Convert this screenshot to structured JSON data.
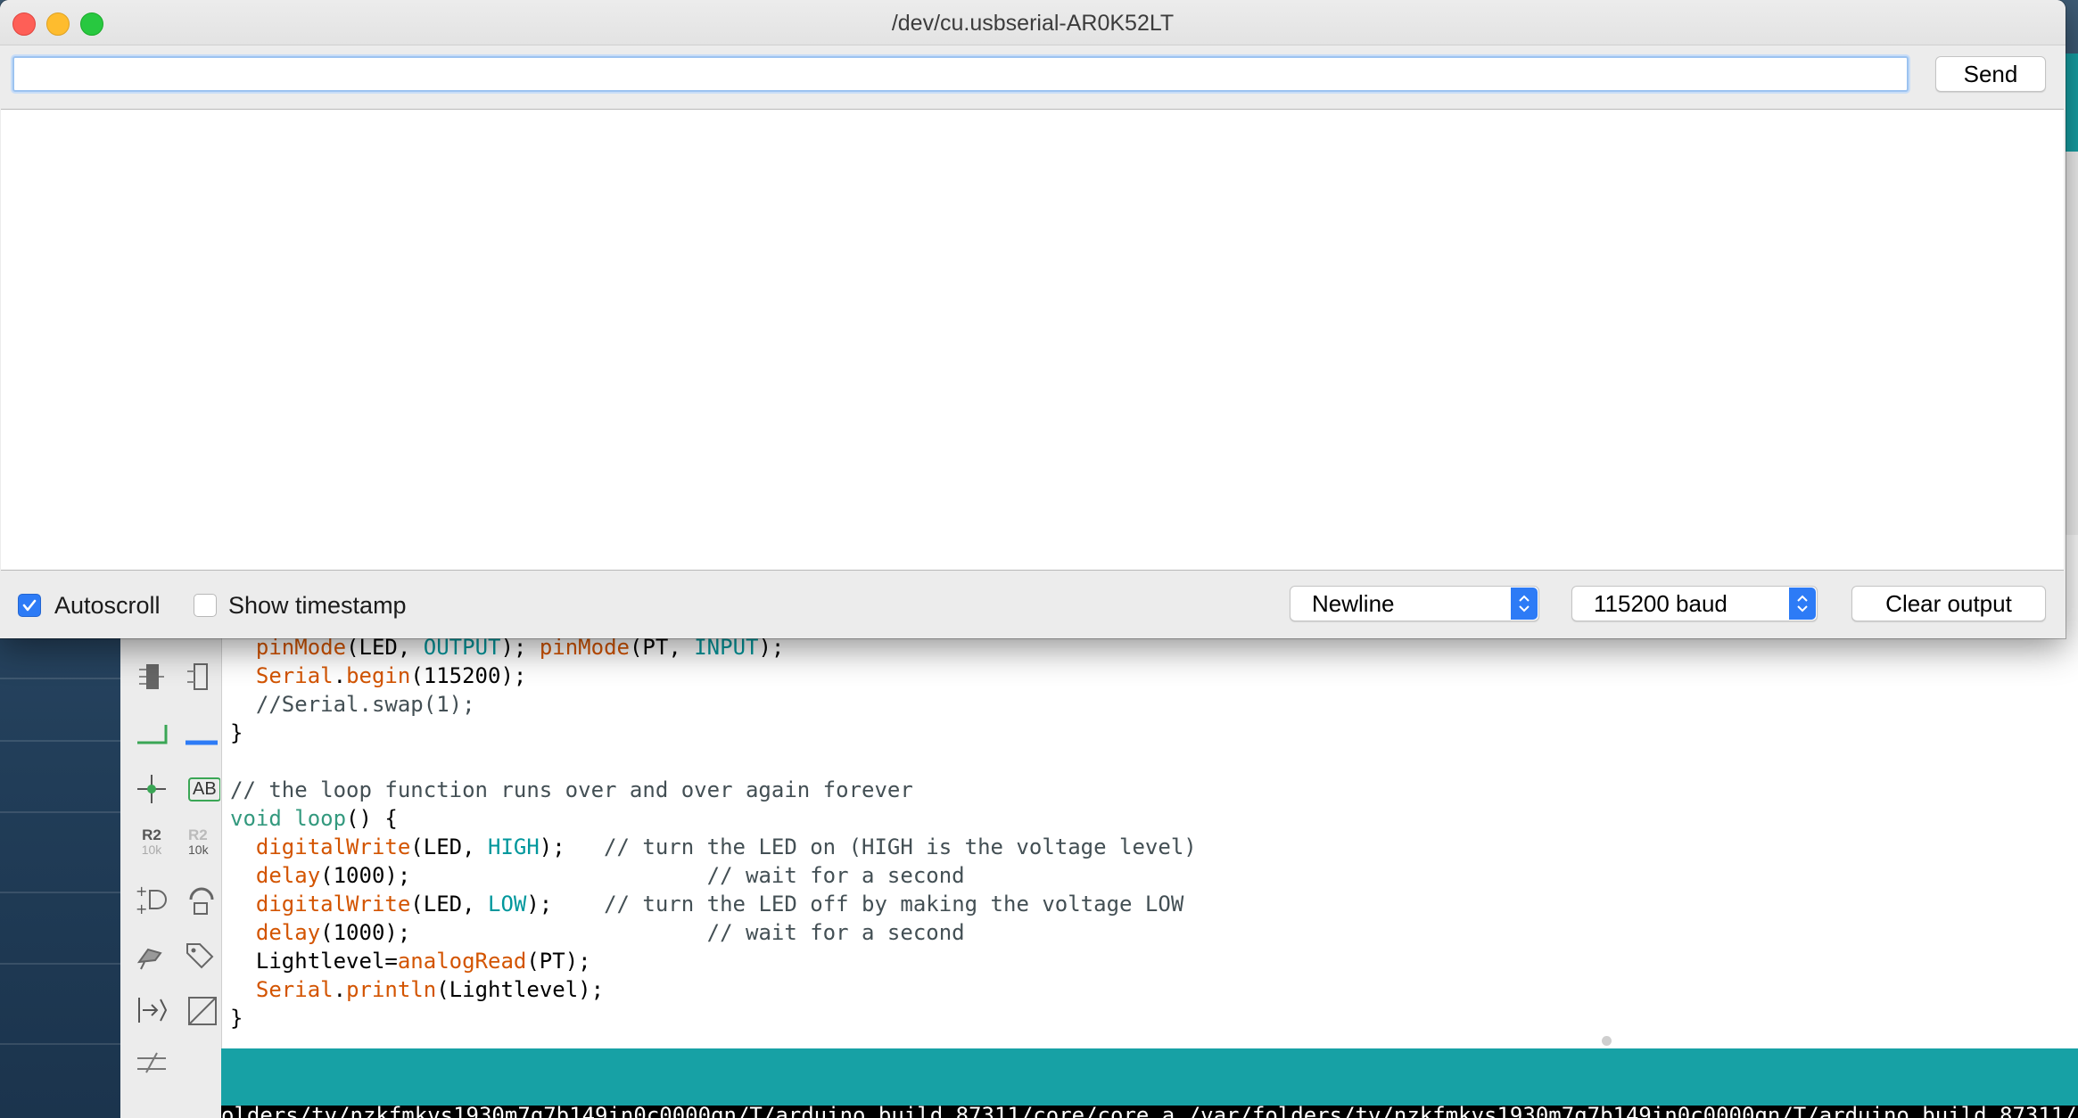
{
  "serial_monitor": {
    "title": "/dev/cu.usbserial-AR0K52LT",
    "input_value": "",
    "send_label": "Send",
    "autoscroll": {
      "label": "Autoscroll",
      "checked": true
    },
    "show_timestamp": {
      "label": "Show timestamp",
      "checked": false
    },
    "line_ending": "Newline",
    "baud_rate": "115200 baud",
    "clear_label": "Clear output",
    "output": ""
  },
  "editor": {
    "tool_labels": {
      "resistor_name": "R2",
      "resistor_value": "10k",
      "text_tool": "AB"
    },
    "code_lines": [
      [
        {
          "t": "  "
        },
        {
          "t": "pinMode",
          "c": "fn"
        },
        {
          "t": "(LED, "
        },
        {
          "t": "OUTPUT",
          "c": "const"
        },
        {
          "t": "); "
        },
        {
          "t": "pinMode",
          "c": "fn"
        },
        {
          "t": "(PT, "
        },
        {
          "t": "INPUT",
          "c": "const"
        },
        {
          "t": ");"
        }
      ],
      [
        {
          "t": "  "
        },
        {
          "t": "Serial",
          "c": "fn"
        },
        {
          "t": "."
        },
        {
          "t": "begin",
          "c": "fn"
        },
        {
          "t": "(115200);"
        }
      ],
      [
        {
          "t": "  //Serial.swap(1);",
          "c": "cm"
        }
      ],
      [
        {
          "t": "}"
        }
      ],
      [
        {
          "t": ""
        }
      ],
      [
        {
          "t": "// the loop function runs over and over again forever",
          "c": "cm"
        }
      ],
      [
        {
          "t": "void",
          "c": "kw"
        },
        {
          "t": " "
        },
        {
          "t": "loop",
          "c": "kw"
        },
        {
          "t": "() {"
        }
      ],
      [
        {
          "t": "  "
        },
        {
          "t": "digitalWrite",
          "c": "fn"
        },
        {
          "t": "(LED, "
        },
        {
          "t": "HIGH",
          "c": "const"
        },
        {
          "t": ");   "
        },
        {
          "t": "// turn the LED on (HIGH is the voltage level)",
          "c": "cm"
        }
      ],
      [
        {
          "t": "  "
        },
        {
          "t": "delay",
          "c": "fn"
        },
        {
          "t": "(1000);                       "
        },
        {
          "t": "// wait for a second",
          "c": "cm"
        }
      ],
      [
        {
          "t": "  "
        },
        {
          "t": "digitalWrite",
          "c": "fn"
        },
        {
          "t": "(LED, "
        },
        {
          "t": "LOW",
          "c": "const"
        },
        {
          "t": ");    "
        },
        {
          "t": "// turn the LED off by making the voltage LOW",
          "c": "cm"
        }
      ],
      [
        {
          "t": "  "
        },
        {
          "t": "delay",
          "c": "fn"
        },
        {
          "t": "(1000);                       "
        },
        {
          "t": "// wait for a second",
          "c": "cm"
        }
      ],
      [
        {
          "t": "  Lightlevel="
        },
        {
          "t": "analogRead",
          "c": "fn"
        },
        {
          "t": "(PT);"
        }
      ],
      [
        {
          "t": "  "
        },
        {
          "t": "Serial",
          "c": "fn"
        },
        {
          "t": "."
        },
        {
          "t": "println",
          "c": "fn"
        },
        {
          "t": "(Lightlevel);"
        }
      ],
      [
        {
          "t": "}"
        }
      ]
    ],
    "console_text": "olders/tv/nzkfmkvs1930m7q7b149in0c0000gn/T/arduino_build_87311/core/core.a /var/folders/tv/nzkfmkvs1930m7q7b149in0c0000gn/T/arduino_build_87311/core"
  },
  "colors": {
    "accent_blue": "#2d7bf6",
    "arduino_teal": "#17a1a5",
    "code_function": "#d35400",
    "code_keyword": "#33997e",
    "code_constant": "#00979c"
  }
}
